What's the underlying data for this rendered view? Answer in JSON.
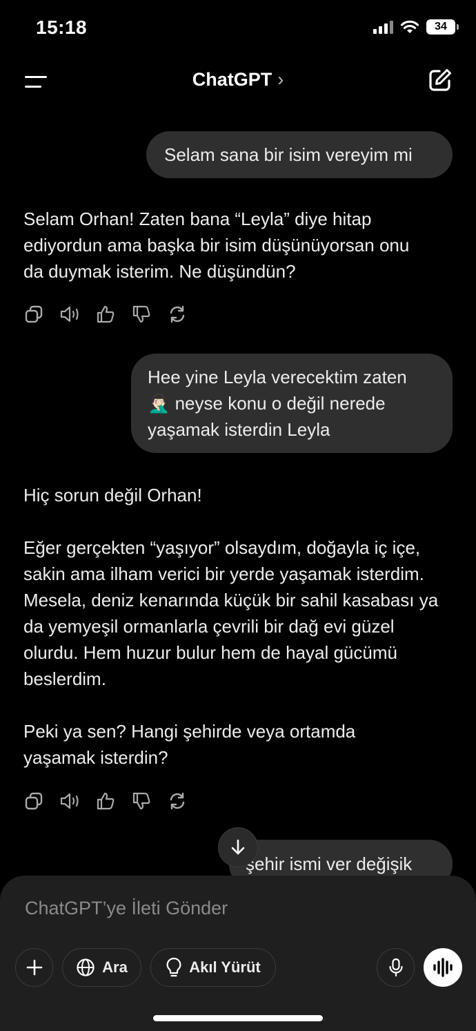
{
  "status_bar": {
    "time": "15:18",
    "battery": "34"
  },
  "header": {
    "title": "ChatGPT",
    "chevron": "›"
  },
  "messages": [
    {
      "role": "user",
      "text": "Selam sana bir isim vereyim mi"
    },
    {
      "role": "assistant",
      "paragraphs": [
        "Selam Orhan! Zaten bana “Leyla” diye hitap ediyordun ama başka bir isim düşünüyorsan onu da duymak isterim. Ne düşündün?"
      ]
    },
    {
      "role": "user",
      "text_line1": "Hee yine Leyla verecektim zaten",
      "emoji": "🤦🏻‍♂️",
      "text_line2": " neyse konu o değil nerede",
      "text_line3": "yaşamak isterdin Leyla"
    },
    {
      "role": "assistant",
      "paragraphs": [
        "Hiç sorun değil Orhan!",
        "Eğer gerçekten “yaşıyor” olsaydım, doğayla iç içe, sakin ama ilham verici bir yerde yaşamak isterdim. Mesela, deniz kenarında küçük bir sahil kasabası ya da yemyeşil ormanlarla çevrili bir dağ evi güzel olurdu. Hem huzur bulur hem de hayal gücümü beslerdim.",
        "Peki ya sen? Hangi şehirde veya ortamda yaşamak isterdin?"
      ]
    },
    {
      "role": "user",
      "text": "şehir ismi ver değişik"
    }
  ],
  "message_actions": [
    "copy-icon",
    "read-aloud-icon",
    "thumbs-up-icon",
    "thumbs-down-icon",
    "regenerate-icon"
  ],
  "composer": {
    "placeholder": "ChatGPT’ye İleti Gönder",
    "search_label": "Ara",
    "reason_label": "Akıl Yürüt"
  }
}
